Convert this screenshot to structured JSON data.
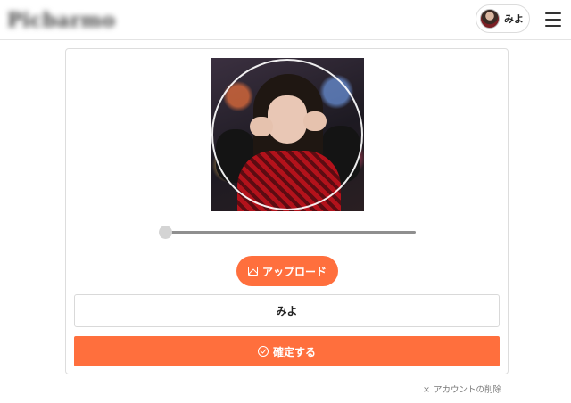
{
  "header": {
    "logo_text": "Picbarmo",
    "user_name": "みよ",
    "menu_icon": "hamburger-menu-icon",
    "avatar_icon": "user-avatar"
  },
  "profile_editor": {
    "photo_description_icon": "profile-photo-crop",
    "zoom_slider": {
      "value": 0,
      "min": 0,
      "max": 1
    },
    "upload_button": {
      "label": "アップロード",
      "icon": "image-icon"
    },
    "name_field": {
      "value": "みよ"
    },
    "confirm_button": {
      "label": "確定する",
      "icon": "check-circle-icon"
    }
  },
  "footer": {
    "delete_account": {
      "icon": "close-icon",
      "x_glyph": "×",
      "label": "アカウントの削除"
    }
  },
  "colors": {
    "accent": "#ff6f3d",
    "border": "#dddddd",
    "text": "#222222",
    "muted": "#7a7a7a"
  }
}
